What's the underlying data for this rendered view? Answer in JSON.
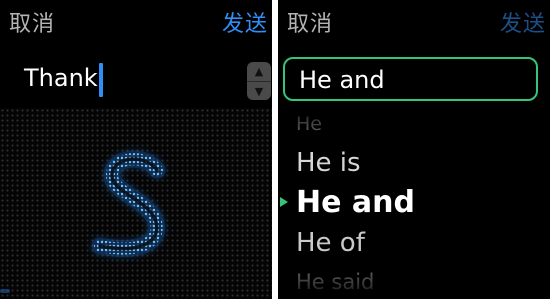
{
  "left_screen": {
    "cancel_label": "取消",
    "send_label": "发送",
    "input_value": "Thank",
    "stepper": {
      "up_icon": "▲",
      "down_icon": "▼"
    },
    "scribble_glyph": "S",
    "colors": {
      "accent": "#2f8ff5",
      "glyph": "#4aa8ff"
    }
  },
  "right_screen": {
    "cancel_label": "取消",
    "send_label": "发送",
    "selected_value": "He and",
    "suggestions": [
      "He",
      "He is",
      "He and",
      "He of",
      "He said"
    ],
    "active_index": 2,
    "colors": {
      "selection_border": "#37c37a"
    }
  }
}
